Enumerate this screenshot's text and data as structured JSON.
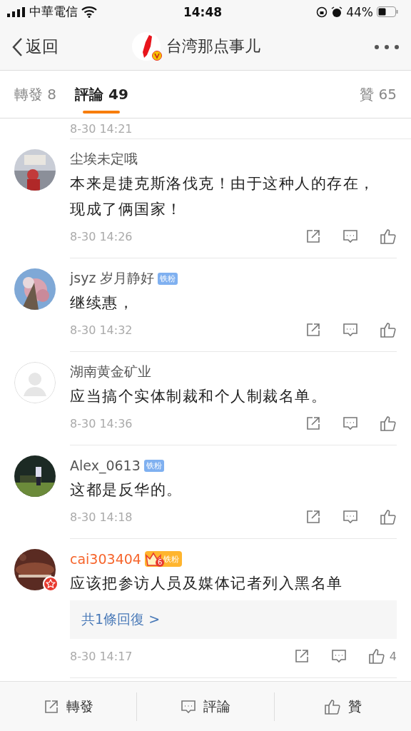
{
  "status_bar": {
    "carrier": "中華電信",
    "time": "14:48",
    "battery": "44%"
  },
  "nav": {
    "back": "返回",
    "title": "台湾那点事儿",
    "verified": true
  },
  "tabs": [
    {
      "label": "轉發 8",
      "selected": false
    },
    {
      "label": "評論 49",
      "selected": true
    },
    {
      "label": "贊 65",
      "selected": false
    }
  ],
  "partial_comment": {
    "time": "8-30 14:21"
  },
  "comments": [
    {
      "name": "尘埃未定哦",
      "kind": "picture",
      "vip": false,
      "verified": false,
      "text": "本来是捷克斯洛伐克！由于这种人的存在，现成了俩国家！",
      "time": "8-30 14:26"
    },
    {
      "name": "jsyz 岁月静好",
      "kind": "picture",
      "vip": false,
      "verified": false,
      "badge": {
        "kind": "fan",
        "label": "铁粉"
      },
      "text": "继续惠，",
      "time": "8-30 14:32"
    },
    {
      "name": "湖南黄金矿业",
      "kind": "default",
      "vip": false,
      "verified": false,
      "text": "应当搞个实体制裁和个人制裁名单。",
      "time": "8-30 14:36"
    },
    {
      "name": "Alex_0613",
      "kind": "picture",
      "vip": false,
      "verified": false,
      "badge": {
        "kind": "fan",
        "label": "铁粉"
      },
      "text": "这都是反华的。",
      "time": "8-30 14:18"
    },
    {
      "name": "cai303404",
      "kind": "picture",
      "vip": true,
      "verified": true,
      "badge": {
        "kind": "crown",
        "label": "铁粉",
        "rank": "6"
      },
      "text": "应该把参访人员及媒体记者列入黑名单",
      "replies": "共1條回復 >",
      "likes": "4",
      "time": "8-30 14:17"
    }
  ],
  "bottom_bar": [
    {
      "kind": "repost",
      "label": "轉發"
    },
    {
      "kind": "comment",
      "label": "評論"
    },
    {
      "kind": "like",
      "label": "贊"
    }
  ]
}
